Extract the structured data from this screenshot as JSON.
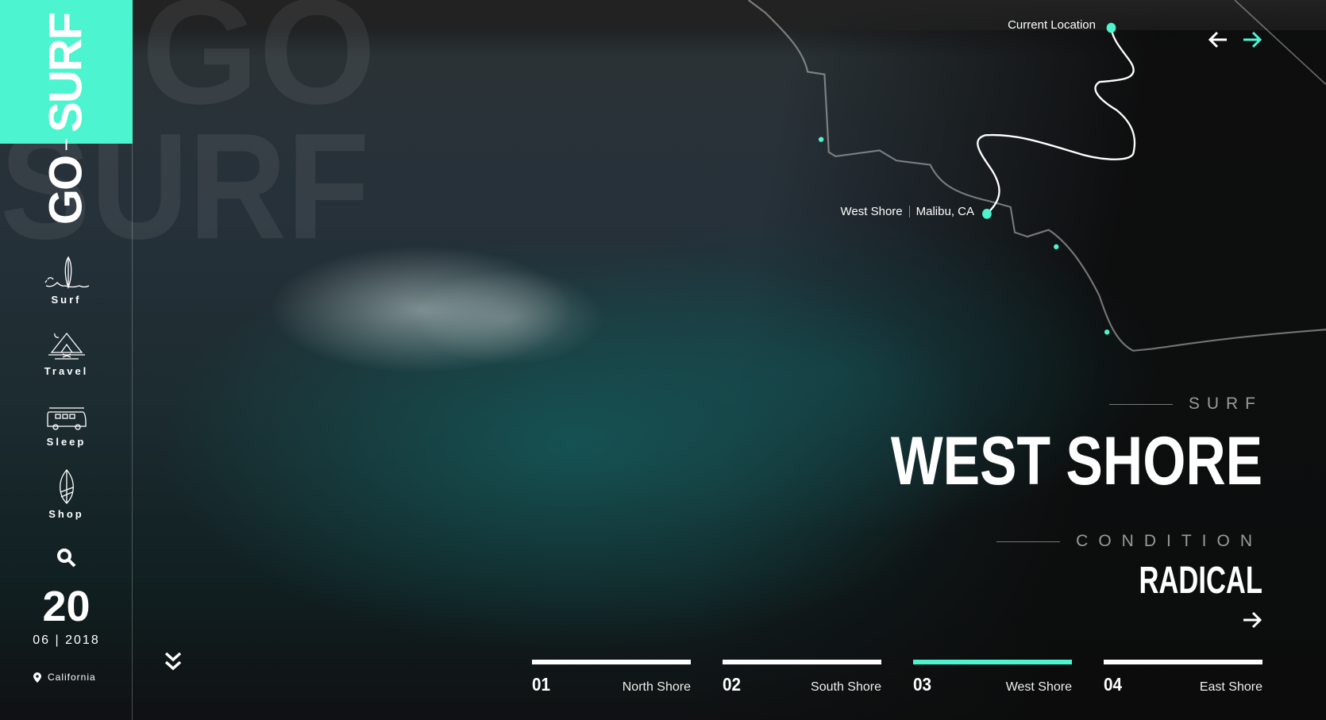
{
  "brand": {
    "word1": "GO",
    "word2": "SURF",
    "ghost_line1": "GO",
    "ghost_line2": "SURF",
    "accent": "#4cf5cf"
  },
  "sidebar": {
    "items": [
      {
        "label": "Surf",
        "icon": "surfboard-wave-icon"
      },
      {
        "label": "Travel",
        "icon": "tent-campfire-icon"
      },
      {
        "label": "Sleep",
        "icon": "camper-van-icon"
      },
      {
        "label": "Shop",
        "icon": "surfboard-icon"
      }
    ],
    "search_icon": "search-icon",
    "date": {
      "day": "20",
      "month_year": "06 | 2018"
    },
    "location": "California"
  },
  "map": {
    "current_location": "Current Location",
    "spot_name": "West Shore",
    "spot_place": "Malibu, CA"
  },
  "nav_arrows": {
    "prev": "arrow-left-icon",
    "next": "arrow-right-icon"
  },
  "hero": {
    "kicker": "SURF",
    "title": "WEST SHORE",
    "condition_label": "CONDITION",
    "condition_value": "RADICAL"
  },
  "tabs": [
    {
      "num": "01",
      "name": "North Shore",
      "active": false
    },
    {
      "num": "02",
      "name": "South Shore",
      "active": false
    },
    {
      "num": "03",
      "name": "West Shore",
      "active": true
    },
    {
      "num": "04",
      "name": "East Shore",
      "active": false
    }
  ]
}
